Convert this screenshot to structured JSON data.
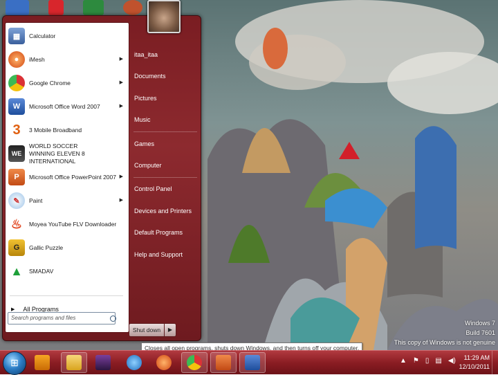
{
  "start_menu": {
    "programs": [
      {
        "label": "Calculator",
        "icon": "calculator-icon",
        "submenu": false
      },
      {
        "label": "iMesh",
        "icon": "imesh-icon",
        "submenu": true
      },
      {
        "label": "Google Chrome",
        "icon": "chrome-icon",
        "submenu": true
      },
      {
        "label": "Microsoft Office Word 2007",
        "icon": "word-icon",
        "submenu": true
      },
      {
        "label": "3 Mobile Broadband",
        "icon": "three-mobile-icon",
        "submenu": false
      },
      {
        "label": "WORLD SOCCER WINNING ELEVEN 8 INTERNATIONAL",
        "icon": "winning-eleven-icon",
        "submenu": false
      },
      {
        "label": "Microsoft Office PowerPoint 2007",
        "icon": "powerpoint-icon",
        "submenu": true
      },
      {
        "label": "Paint",
        "icon": "paint-icon",
        "submenu": true
      },
      {
        "label": "Moyea YouTube FLV Downloader",
        "icon": "moyea-icon",
        "submenu": false
      },
      {
        "label": "Gallic Puzzle",
        "icon": "gallic-puzzle-icon",
        "submenu": false
      },
      {
        "label": "SMADAV",
        "icon": "smadav-icon",
        "submenu": false
      }
    ],
    "all_programs": "All Programs",
    "search_placeholder": "Search programs and files",
    "right_items": [
      "itaa_itaa",
      "Documents",
      "Pictures",
      "Music",
      "Games",
      "Computer",
      "Control Panel",
      "Devices and Printers",
      "Default Programs",
      "Help and Support"
    ],
    "shutdown_label": "Shut down",
    "shutdown_tooltip": "Closes all open programs, shuts down Windows, and then turns off your computer."
  },
  "watermark": {
    "line1": "Windows 7",
    "line2": "Build 7601",
    "line3": "This copy of Windows is not genuine"
  },
  "taskbar": {
    "clock_time": "11:29 AM",
    "clock_date": "12/10/2011",
    "pinned": [
      "windows-media-player-icon",
      "windows-explorer-icon",
      "game-icon",
      "internet-explorer-icon",
      "imesh-icon",
      "chrome-icon",
      "powerpoint-icon",
      "word-icon"
    ]
  },
  "colors": {
    "start_menu_bg": "#8d2a2f",
    "taskbar_bg": "#8b1d23"
  }
}
